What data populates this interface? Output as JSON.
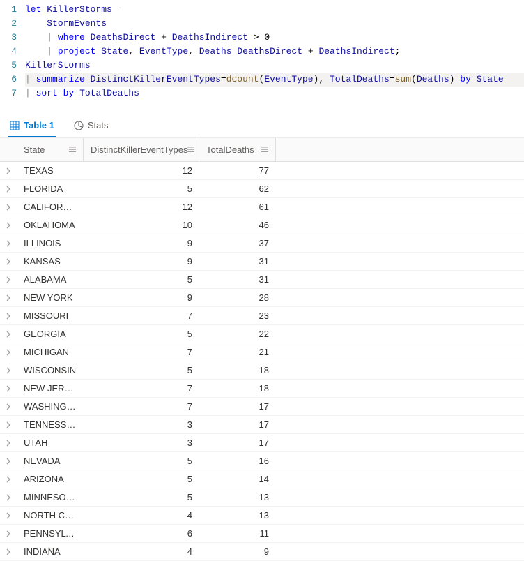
{
  "editor": {
    "lines": [
      {
        "n": 1,
        "hl": false,
        "html": "<span class='kw'>let</span> <span class='id'>KillerStorms</span> <span class='op'>=</span>"
      },
      {
        "n": 2,
        "hl": false,
        "html": "    <span class='id'>StormEvents</span>"
      },
      {
        "n": 3,
        "hl": false,
        "html": "    <span class='pipe'>|</span> <span class='kw'>where</span> <span class='id'>DeathsDirect</span> <span class='op'>+</span> <span class='id'>DeathsIndirect</span> <span class='op'>&gt;</span> <span class='op'>0</span>"
      },
      {
        "n": 4,
        "hl": false,
        "html": "    <span class='pipe'>|</span> <span class='kw'>project</span> <span class='id'>State</span><span class='op'>,</span> <span class='id'>EventType</span><span class='op'>,</span> <span class='id'>Deaths</span><span class='op'>=</span><span class='id'>DeathsDirect</span> <span class='op'>+</span> <span class='id'>DeathsIndirect</span><span class='op'>;</span>"
      },
      {
        "n": 5,
        "hl": false,
        "html": "<span class='id'>KillerStorms</span>"
      },
      {
        "n": 6,
        "hl": true,
        "html": "<span class='pipe'>|</span> <span class='kw'>summarize</span> <span class='id'>DistinctKillerEventTypes</span><span class='op'>=</span><span class='fn'>dcount</span><span class='op'>(</span><span class='id'>EventType</span><span class='op'>),</span> <span class='id'>TotalDeaths</span><span class='op'>=</span><span class='fn'>sum</span><span class='op'>(</span><span class='id'>Deaths</span><span class='op'>)</span> <span class='kw'>by</span> <span class='id'>State</span>"
      },
      {
        "n": 7,
        "hl": false,
        "html": "<span class='pipe'>|</span> <span class='kw'>sort</span> <span class='kw'>by</span> <span class='id'>TotalDeaths</span>"
      }
    ]
  },
  "tabs": {
    "table": "Table 1",
    "stats": "Stats"
  },
  "columns": {
    "state": "State",
    "dket": "DistinctKillerEventTypes",
    "td": "TotalDeaths"
  },
  "rows": [
    {
      "state": "TEXAS",
      "dket": 12,
      "td": 77
    },
    {
      "state": "FLORIDA",
      "dket": 5,
      "td": 62
    },
    {
      "state": "CALIFORNIA",
      "dket": 12,
      "td": 61
    },
    {
      "state": "OKLAHOMA",
      "dket": 10,
      "td": 46
    },
    {
      "state": "ILLINOIS",
      "dket": 9,
      "td": 37
    },
    {
      "state": "KANSAS",
      "dket": 9,
      "td": 31
    },
    {
      "state": "ALABAMA",
      "dket": 5,
      "td": 31
    },
    {
      "state": "NEW YORK",
      "dket": 9,
      "td": 28
    },
    {
      "state": "MISSOURI",
      "dket": 7,
      "td": 23
    },
    {
      "state": "GEORGIA",
      "dket": 5,
      "td": 22
    },
    {
      "state": "MICHIGAN",
      "dket": 7,
      "td": 21
    },
    {
      "state": "WISCONSIN",
      "dket": 5,
      "td": 18
    },
    {
      "state": "NEW JERSEY",
      "dket": 7,
      "td": 18
    },
    {
      "state": "WASHINGT...",
      "dket": 7,
      "td": 17
    },
    {
      "state": "TENNESSEE",
      "dket": 3,
      "td": 17
    },
    {
      "state": "UTAH",
      "dket": 3,
      "td": 17
    },
    {
      "state": "NEVADA",
      "dket": 5,
      "td": 16
    },
    {
      "state": "ARIZONA",
      "dket": 5,
      "td": 14
    },
    {
      "state": "MINNESOTA",
      "dket": 5,
      "td": 13
    },
    {
      "state": "NORTH CA...",
      "dket": 4,
      "td": 13
    },
    {
      "state": "PENNSYLV...",
      "dket": 6,
      "td": 11
    },
    {
      "state": "INDIANA",
      "dket": 4,
      "td": 9
    }
  ]
}
